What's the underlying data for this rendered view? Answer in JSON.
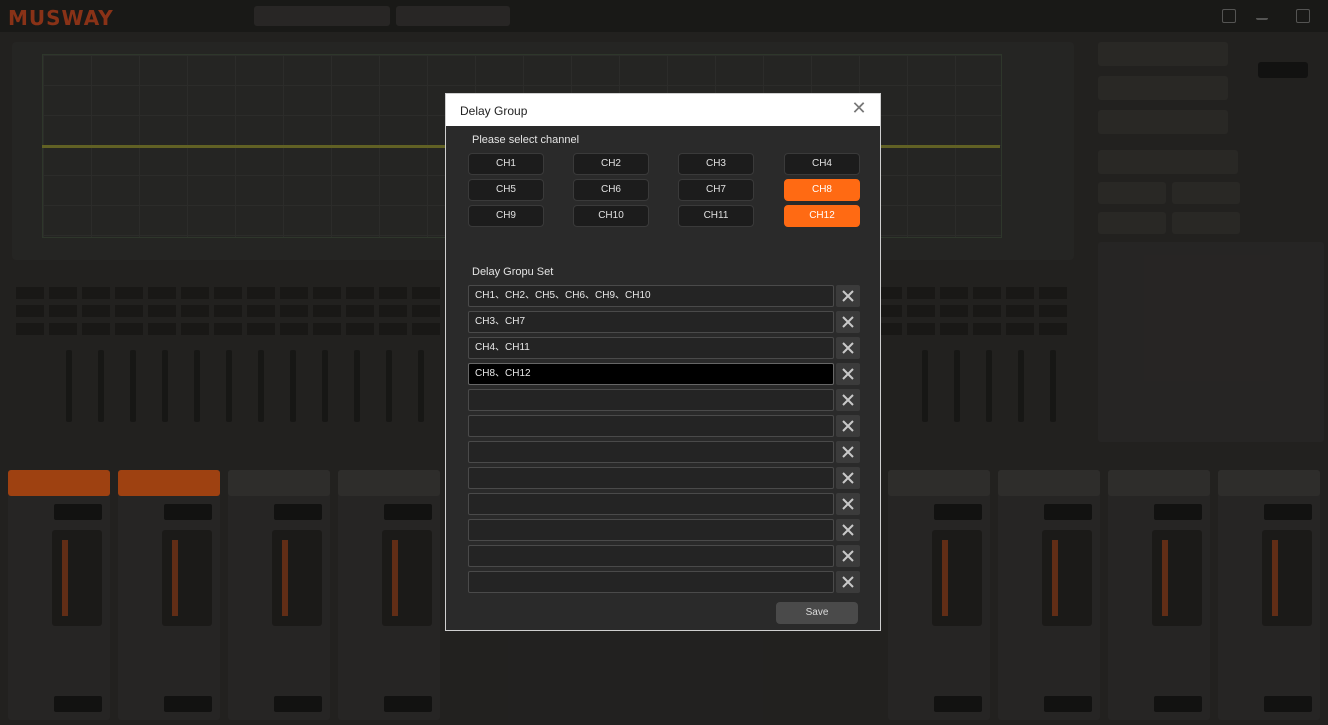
{
  "dialog": {
    "title": "Delay Group",
    "select_label": "Please select channel",
    "group_label": "Delay Gropu Set",
    "save_label": "Save",
    "accent_color": "#ff6a13"
  },
  "channels": [
    {
      "label": "CH1",
      "selected": false
    },
    {
      "label": "CH2",
      "selected": false
    },
    {
      "label": "CH3",
      "selected": false
    },
    {
      "label": "CH4",
      "selected": false
    },
    {
      "label": "CH5",
      "selected": false
    },
    {
      "label": "CH6",
      "selected": false
    },
    {
      "label": "CH7",
      "selected": false
    },
    {
      "label": "CH8",
      "selected": true
    },
    {
      "label": "CH9",
      "selected": false
    },
    {
      "label": "CH10",
      "selected": false
    },
    {
      "label": "CH11",
      "selected": false
    },
    {
      "label": "CH12",
      "selected": true
    }
  ],
  "groups": [
    {
      "value": "CH1、CH2、CH5、CH6、CH9、CH10",
      "selected": false
    },
    {
      "value": "CH3、CH7",
      "selected": false
    },
    {
      "value": "CH4、CH11",
      "selected": false
    },
    {
      "value": "CH8、CH12",
      "selected": true
    },
    {
      "value": "",
      "selected": false
    },
    {
      "value": "",
      "selected": false
    },
    {
      "value": "",
      "selected": false
    },
    {
      "value": "",
      "selected": false
    },
    {
      "value": "",
      "selected": false
    },
    {
      "value": "",
      "selected": false
    },
    {
      "value": "",
      "selected": false
    },
    {
      "value": "",
      "selected": false
    }
  ],
  "icons": {
    "close": "close-icon",
    "delete": "delete-x-icon"
  }
}
